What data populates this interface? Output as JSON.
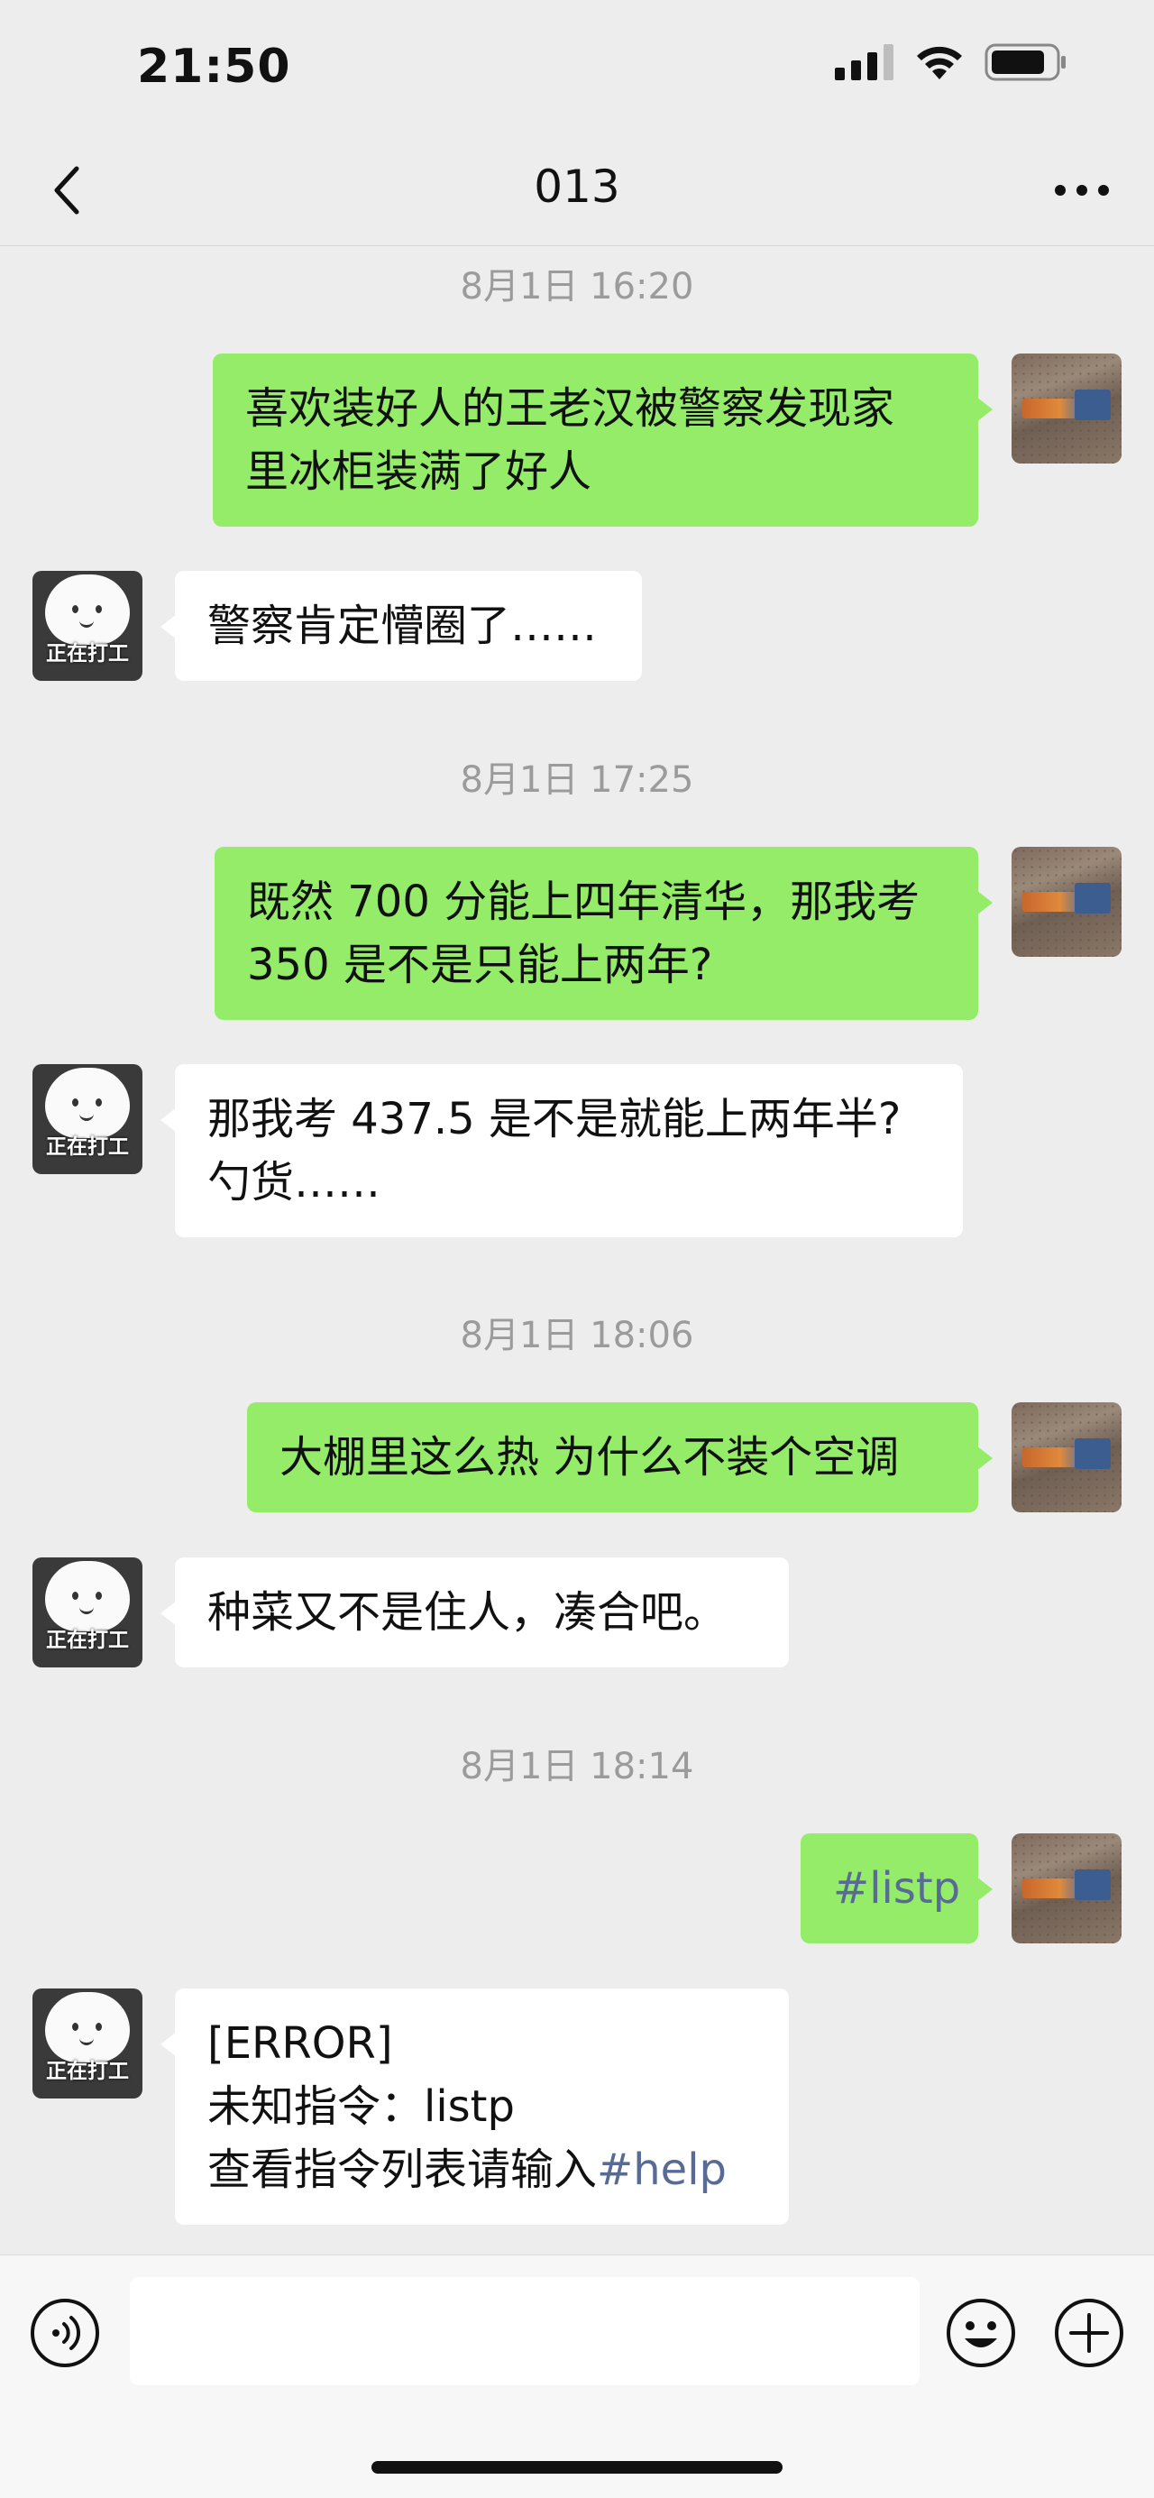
{
  "status_bar": {
    "time": "21:50"
  },
  "nav": {
    "title": "013"
  },
  "messages": [
    {
      "timestamp": "8月1日 16:20"
    },
    {
      "sender": "me",
      "lines": [
        "喜欢装好人的王老汉被警察发现家",
        "里冰柜装满了好人"
      ]
    },
    {
      "sender": "bot",
      "avatar_label": "正在打工",
      "lines": [
        "警察肯定懵圈了……"
      ]
    },
    {
      "timestamp": "8月1日 17:25"
    },
    {
      "sender": "me",
      "lines": [
        "既然 700 分能上四年清华，那我考",
        "350 是不是只能上两年?"
      ]
    },
    {
      "sender": "bot",
      "avatar_label": "正在打工",
      "lines": [
        "那我考 437.5 是不是就能上两年半?",
        "勺货……"
      ]
    },
    {
      "timestamp": "8月1日 18:06"
    },
    {
      "sender": "me",
      "lines": [
        "大棚里这么热 为什么不装个空调"
      ]
    },
    {
      "sender": "bot",
      "avatar_label": "正在打工",
      "lines": [
        "种菜又不是住人，凑合吧。"
      ]
    },
    {
      "timestamp": "8月1日 18:14"
    },
    {
      "sender": "me",
      "lines": [
        "#listp"
      ]
    },
    {
      "sender": "bot",
      "avatar_label": "正在打工",
      "lines": [
        "[ERROR]",
        "未知指令：listp",
        "查看指令列表请输入"
      ],
      "link": "#help"
    }
  ],
  "colors": {
    "background": "#ededed",
    "me_bubble": "#95ec69",
    "bot_bubble": "#ffffff",
    "hashtag": "#576b95",
    "timestamp": "#9b9b9b"
  },
  "icons": [
    "back-icon",
    "more-icon",
    "signal-icon",
    "wifi-icon",
    "battery-icon",
    "voice-icon",
    "emoji-icon",
    "plus-icon"
  ]
}
